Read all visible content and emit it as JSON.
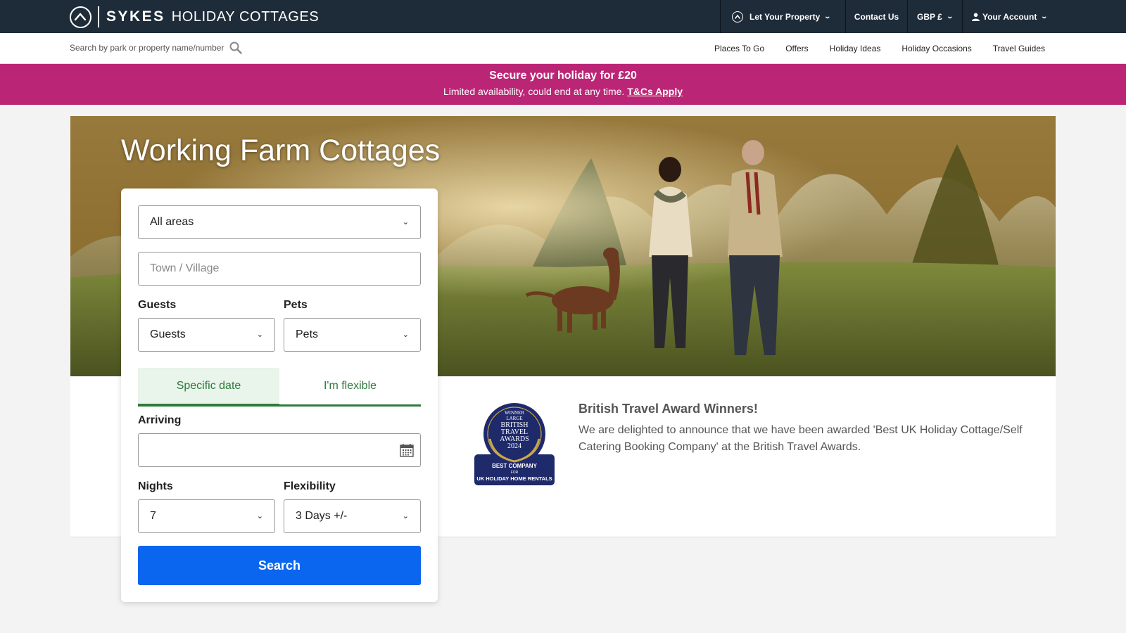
{
  "header": {
    "brand_bold": "SYKES",
    "brand_rest": "HOLIDAY COTTAGES",
    "nav": {
      "let_property": "Let Your Property",
      "contact": "Contact Us",
      "currency": "GBP £",
      "account": "Your Account"
    }
  },
  "subheader": {
    "search_placeholder": "Search by park or property name/number",
    "links": [
      "Places To Go",
      "Offers",
      "Holiday Ideas",
      "Holiday Occasions",
      "Travel Guides"
    ]
  },
  "promo": {
    "title": "Secure your holiday for £20",
    "subtitle": "Limited availability, could end at any time.",
    "link": "T&Cs Apply"
  },
  "hero": {
    "title": "Working Farm Cottages"
  },
  "search_form": {
    "area_value": "All areas",
    "town_placeholder": "Town / Village",
    "guests_label": "Guests",
    "guests_value": "Guests",
    "pets_label": "Pets",
    "pets_value": "Pets",
    "tabs": [
      "Specific date",
      "I'm flexible"
    ],
    "arriving_label": "Arriving",
    "arriving_value": "",
    "nights_label": "Nights",
    "nights_value": "7",
    "flexibility_label": "Flexibility",
    "flexibility_value": "3 Days +/-",
    "search_button": "Search"
  },
  "award": {
    "badge_lines": [
      "WINNER",
      "LARGE",
      "BRITISH",
      "TRAVEL",
      "AWARDS",
      "2024",
      "BEST COMPANY",
      "FOR",
      "UK HOLIDAY HOME RENTALS"
    ],
    "title": "British Travel Award Winners!",
    "text": "We are delighted to announce that we have been awarded 'Best UK Holiday Cottage/Self Catering Booking Company' at the British Travel Awards."
  },
  "colors": {
    "topbar": "#1e2b38",
    "promo": "#bb2575",
    "accent_green": "#2d7a3c",
    "button_blue": "#0a66ee",
    "badge_navy": "#1f2a6b"
  },
  "icons": {
    "logo": "sykes-logo-icon",
    "search": "search-icon",
    "account": "user-icon",
    "calendar": "calendar-icon",
    "dropdown": "chevron-down-icon"
  }
}
